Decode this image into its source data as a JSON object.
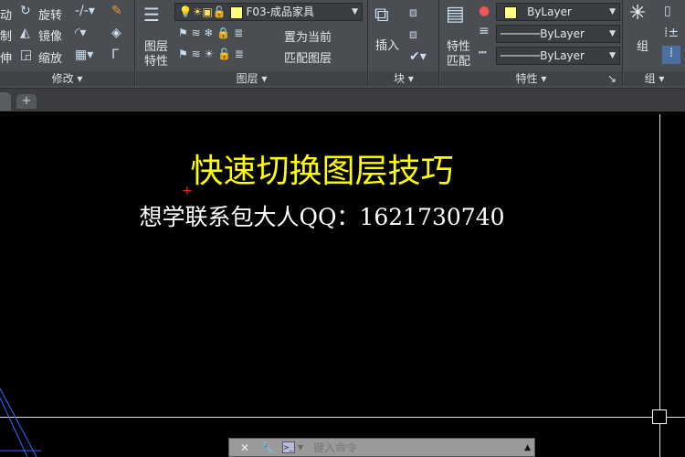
{
  "ribbon": {
    "modify": {
      "title": "修改",
      "items": [
        "动",
        "制",
        "伸",
        "旋转",
        "镜像",
        "缩放"
      ]
    },
    "layers": {
      "title": "图层",
      "layer_props": [
        "图层",
        "特性"
      ],
      "current_layer": "F03-成品家具",
      "set_current": "置为当前",
      "match_layer": "匹配图层"
    },
    "block": {
      "title": "块",
      "insert": "插入"
    },
    "properties": {
      "title": "特性",
      "match": [
        "特性",
        "匹配"
      ],
      "color": "ByLayer",
      "linetype": "ByLayer",
      "lineweight": "ByLayer",
      "color_swatch": "#ffff80"
    },
    "group": {
      "title": "组",
      "group": "组"
    }
  },
  "tabs": {
    "add": "+"
  },
  "drawing": {
    "title": "快速切换图层技巧",
    "subtitle": "想学联系包大人QQ：1621730740"
  },
  "command": {
    "placeholder": "键入命令"
  }
}
